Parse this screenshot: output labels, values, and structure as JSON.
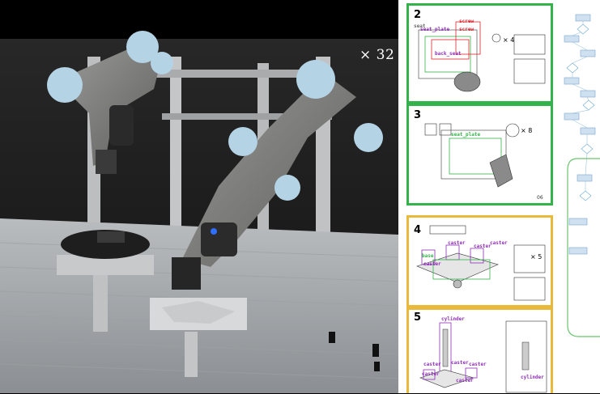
{
  "video": {
    "speed_label": "× 32"
  },
  "steps": [
    {
      "number": "2",
      "labels": [
        "seat_plate",
        "screw",
        "screw",
        "seat",
        "back_seat"
      ],
      "count": "× 4"
    },
    {
      "number": "3",
      "labels": [
        "seat_plate"
      ],
      "count": "× 8",
      "page": "06"
    },
    {
      "number": "4",
      "labels": [
        "caster",
        "caster",
        "caster",
        "base",
        "caster"
      ],
      "count": "× 5"
    },
    {
      "number": "5",
      "labels": [
        "cylinder",
        "caster",
        "caster",
        "caster",
        "caster",
        "caster",
        "cylinder"
      ]
    }
  ],
  "colors": {
    "step_group_a": "#34b34a",
    "step_group_b": "#e8b93b",
    "label_red": "#d9262c",
    "label_purple": "#8e2fb5",
    "flow_node": "#7aa7cf",
    "flow_group": "#6cc36e"
  }
}
